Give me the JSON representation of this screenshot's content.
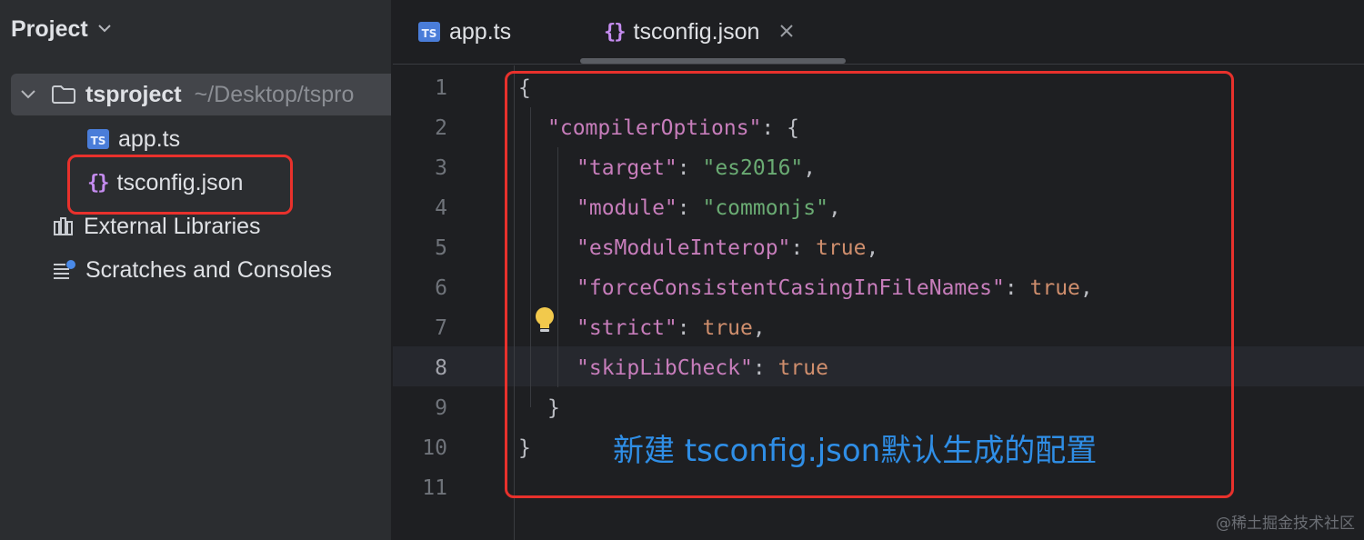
{
  "sidebar": {
    "title": "Project",
    "tree": {
      "root_name": "tsproject",
      "root_path": "~/Desktop/tspro",
      "files": [
        {
          "name": "app.ts",
          "icon": "typescript-file-icon",
          "badge": "TS"
        },
        {
          "name": "tsconfig.json",
          "icon": "json-file-icon",
          "badge": "{}"
        }
      ],
      "external_libraries": "External Libraries",
      "scratches": "Scratches and Consoles"
    }
  },
  "tabs": [
    {
      "label": "app.ts",
      "icon": "typescript-file-icon",
      "badge": "TS",
      "active": false
    },
    {
      "label": "tsconfig.json",
      "icon": "json-file-icon",
      "badge": "{}",
      "active": true
    }
  ],
  "editor": {
    "current_line": 8,
    "lines": [
      {
        "no": "1",
        "text": "{"
      },
      {
        "no": "2",
        "key": "\"compilerOptions\"",
        "rest": ": {"
      },
      {
        "no": "3",
        "key": "\"target\"",
        "sep": ": ",
        "str": "\"es2016\"",
        "tail": ","
      },
      {
        "no": "4",
        "key": "\"module\"",
        "sep": ": ",
        "str": "\"commonjs\"",
        "tail": ","
      },
      {
        "no": "5",
        "key": "\"esModuleInterop\"",
        "sep": ": ",
        "bool": "true",
        "tail": ","
      },
      {
        "no": "6",
        "key": "\"forceConsistentCasingInFileNames\"",
        "sep": ": ",
        "bool": "true",
        "tail": ","
      },
      {
        "no": "7",
        "key": "\"strict\"",
        "sep": ": ",
        "bool": "true",
        "tail": ","
      },
      {
        "no": "8",
        "key": "\"skipLibCheck\"",
        "sep": ": ",
        "bool": "true",
        "tail": ""
      },
      {
        "no": "9",
        "text": "}"
      },
      {
        "no": "10",
        "text": "}"
      },
      {
        "no": "11",
        "text": ""
      }
    ]
  },
  "annotation": "新建 tsconfig.json默认生成的配置",
  "watermark": "@稀土掘金技术社区",
  "colors": {
    "highlight_box": "#e8312c",
    "annotation_text": "#2f8ee6",
    "json_key": "#c77dbb",
    "json_string": "#6aab73",
    "json_boolean": "#cf8e6d"
  }
}
